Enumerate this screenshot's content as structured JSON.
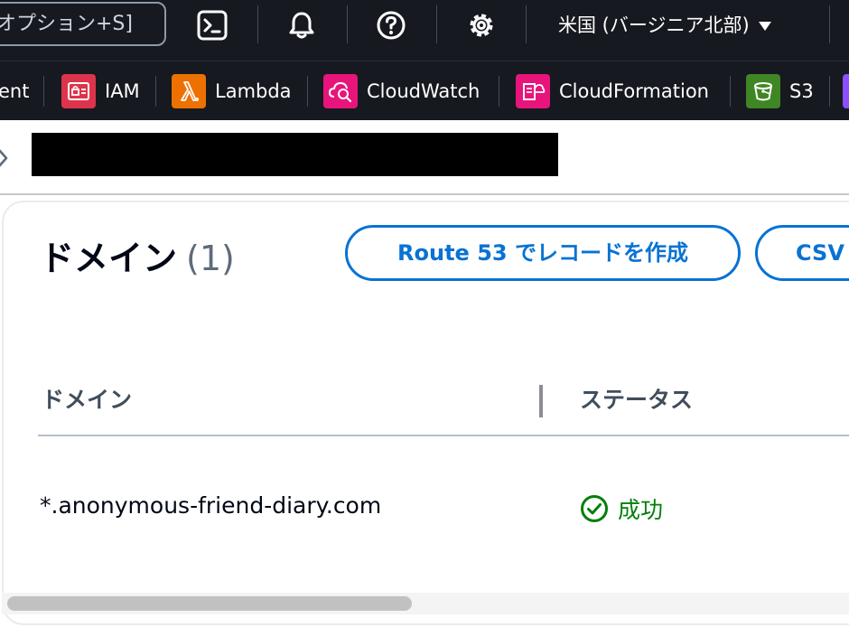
{
  "topbar": {
    "search_shortcut": "オプション+S]",
    "region": "米国 (バージニア北部)",
    "icons": [
      "cloudshell-icon",
      "bell-icon",
      "help-icon",
      "gear-icon"
    ]
  },
  "favorites": [
    {
      "label": "ent",
      "icon": "",
      "color": ""
    },
    {
      "label": "IAM",
      "icon": "iam-icon",
      "color": "#dd344c"
    },
    {
      "label": "Lambda",
      "icon": "lambda-icon",
      "color": "#ed7100"
    },
    {
      "label": "CloudWatch",
      "icon": "cloudwatch-icon",
      "color": "#e7157b"
    },
    {
      "label": "CloudFormation",
      "icon": "cloudformation-icon",
      "color": "#e7157b"
    },
    {
      "label": "S3",
      "icon": "s3-icon",
      "color": "#3f8624"
    }
  ],
  "domains_panel": {
    "title": "ドメイン",
    "count": "(1)",
    "create_route53_button": "Route 53 でレコードを作成",
    "export_csv_button": "CSV",
    "columns": [
      "ドメイン",
      "ステータス"
    ],
    "rows": [
      {
        "domain": "*.anonymous-friend-diary.com",
        "status": "成功"
      }
    ]
  },
  "colors": {
    "nav_bg": "#16191f",
    "link_blue": "#0972d3",
    "success_green": "#037f0c"
  }
}
